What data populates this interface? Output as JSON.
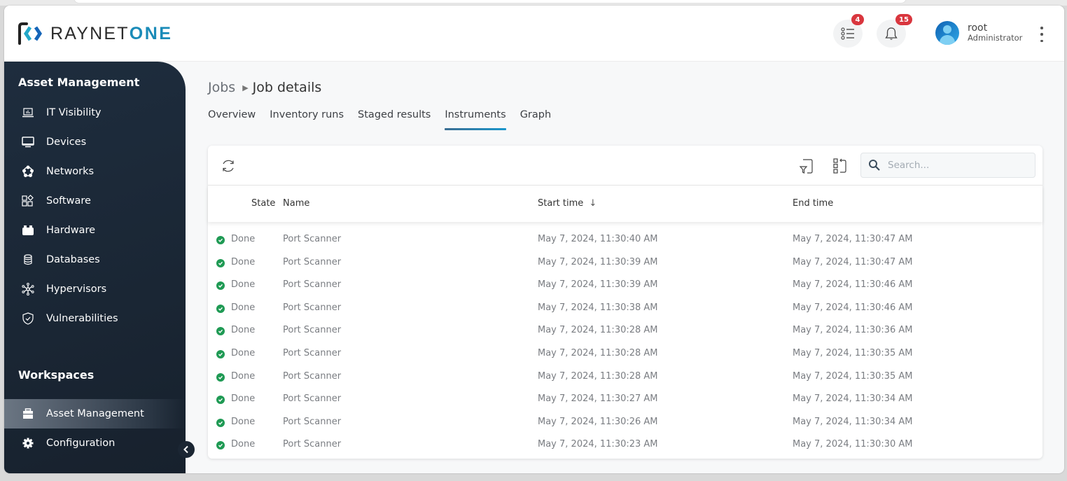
{
  "app": {
    "logo_text_main": "RAYNET",
    "logo_text_accent": "ONE",
    "brand_color": "#1a8bb8"
  },
  "header": {
    "tasks_badge": "4",
    "notifications_badge": "15",
    "user_name": "root",
    "user_role": "Administrator"
  },
  "sidebar": {
    "section_title": "Asset Management",
    "items": [
      {
        "label": "IT Visibility",
        "icon": "laptop-chart-icon"
      },
      {
        "label": "Devices",
        "icon": "monitor-icon"
      },
      {
        "label": "Networks",
        "icon": "network-icon"
      },
      {
        "label": "Software",
        "icon": "apps-icon"
      },
      {
        "label": "Hardware",
        "icon": "hardware-icon"
      },
      {
        "label": "Databases",
        "icon": "database-icon"
      },
      {
        "label": "Hypervisors",
        "icon": "hypervisor-icon"
      },
      {
        "label": "Vulnerabilities",
        "icon": "shield-check-icon"
      }
    ],
    "workspaces_title": "Workspaces",
    "workspaces": [
      {
        "label": "Asset Management",
        "icon": "briefcase-icon",
        "active": true
      },
      {
        "label": "Configuration",
        "icon": "gear-icon",
        "active": false
      }
    ]
  },
  "breadcrumb": {
    "parent": "Jobs",
    "current": "Job details"
  },
  "tabs": [
    {
      "label": "Overview",
      "active": false
    },
    {
      "label": "Inventory runs",
      "active": false
    },
    {
      "label": "Staged results",
      "active": false
    },
    {
      "label": "Instruments",
      "active": true
    },
    {
      "label": "Graph",
      "active": false
    }
  ],
  "toolbar": {
    "search_placeholder": "Search...",
    "search_value": ""
  },
  "table": {
    "columns": [
      "State",
      "Name",
      "Start time",
      "End time"
    ],
    "sort_column": "Start time",
    "sort_indicator": "↓",
    "rows": [
      {
        "state": "Done",
        "name": "Port Scanner",
        "start": "May 7, 2024, 11:30:40 AM",
        "end": "May 7, 2024, 11:30:47 AM"
      },
      {
        "state": "Done",
        "name": "Port Scanner",
        "start": "May 7, 2024, 11:30:39 AM",
        "end": "May 7, 2024, 11:30:47 AM"
      },
      {
        "state": "Done",
        "name": "Port Scanner",
        "start": "May 7, 2024, 11:30:39 AM",
        "end": "May 7, 2024, 11:30:46 AM"
      },
      {
        "state": "Done",
        "name": "Port Scanner",
        "start": "May 7, 2024, 11:30:38 AM",
        "end": "May 7, 2024, 11:30:46 AM"
      },
      {
        "state": "Done",
        "name": "Port Scanner",
        "start": "May 7, 2024, 11:30:28 AM",
        "end": "May 7, 2024, 11:30:36 AM"
      },
      {
        "state": "Done",
        "name": "Port Scanner",
        "start": "May 7, 2024, 11:30:28 AM",
        "end": "May 7, 2024, 11:30:35 AM"
      },
      {
        "state": "Done",
        "name": "Port Scanner",
        "start": "May 7, 2024, 11:30:28 AM",
        "end": "May 7, 2024, 11:30:35 AM"
      },
      {
        "state": "Done",
        "name": "Port Scanner",
        "start": "May 7, 2024, 11:30:27 AM",
        "end": "May 7, 2024, 11:30:34 AM"
      },
      {
        "state": "Done",
        "name": "Port Scanner",
        "start": "May 7, 2024, 11:30:26 AM",
        "end": "May 7, 2024, 11:30:34 AM"
      },
      {
        "state": "Done",
        "name": "Port Scanner",
        "start": "May 7, 2024, 11:30:23 AM",
        "end": "May 7, 2024, 11:30:30 AM"
      }
    ]
  }
}
